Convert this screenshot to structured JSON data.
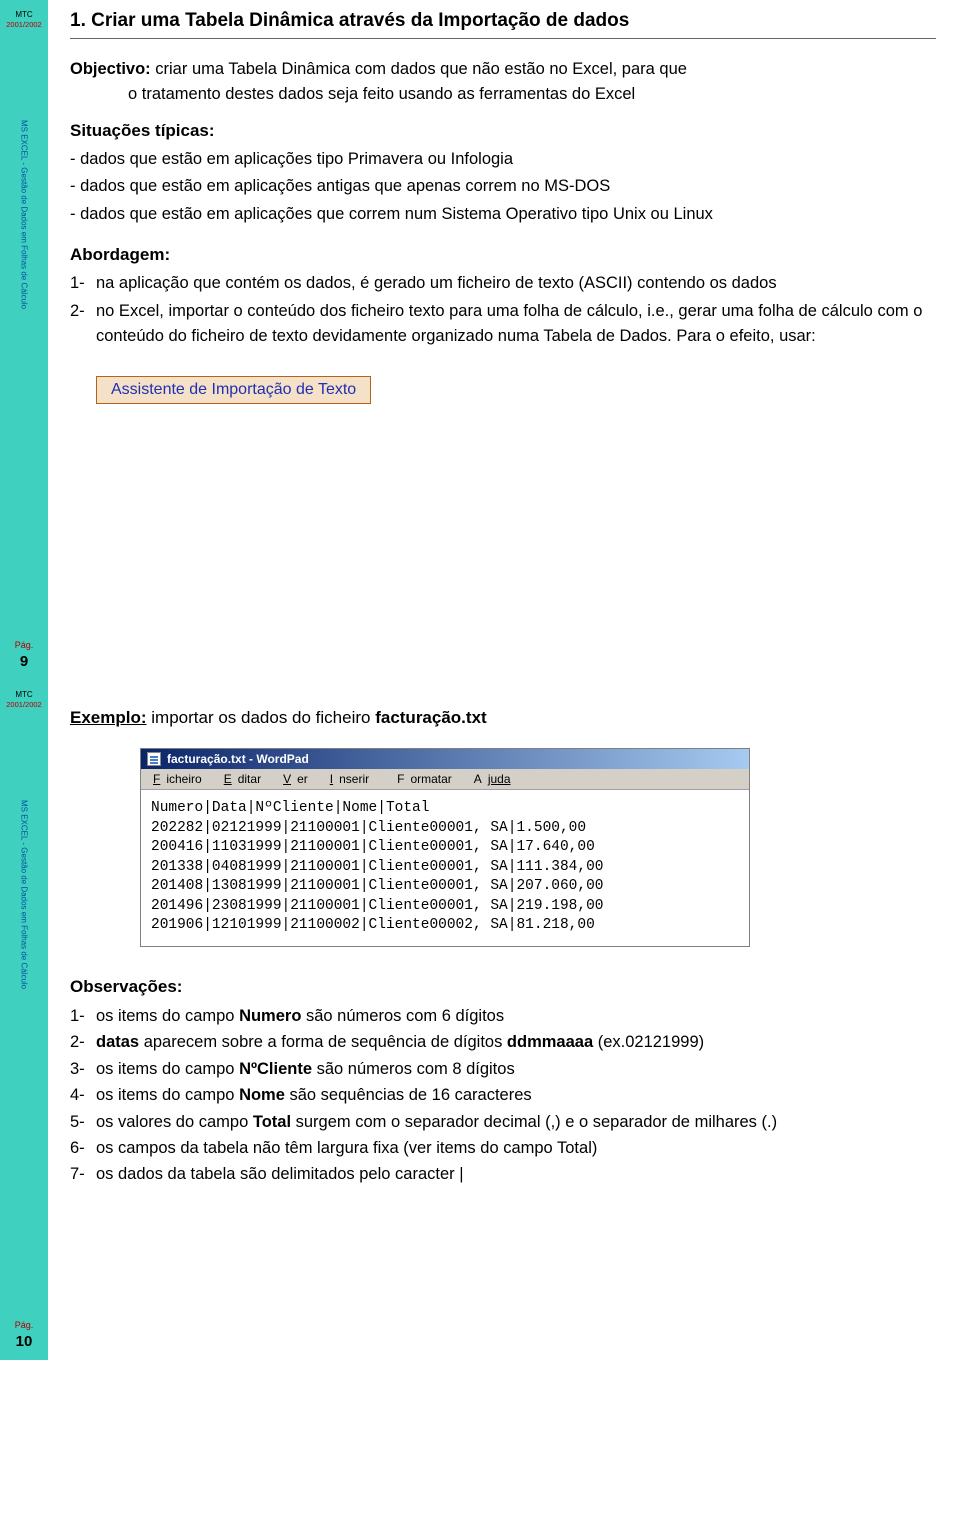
{
  "sidebar": {
    "mtc": "MTC",
    "year": "2001/2002",
    "vertical": "MS EXCEL - Gestão de Dados em Folhas de Cálculo",
    "pag_label": "Pág.",
    "page1_num": "9",
    "page2_num": "10"
  },
  "section1": {
    "title": "1. Criar uma Tabela Dinâmica através da Importação de dados",
    "objectivo_label": "Objectivo:",
    "objectivo_text1": " criar uma Tabela Dinâmica com dados que não estão no Excel, para que",
    "objectivo_text2": "o tratamento destes dados seja feito usando as ferramentas do Excel",
    "situacoes_label": "Situações típicas:",
    "sit_b1": "- dados que estão em aplicações tipo Primavera ou Infologia",
    "sit_b2": "- dados que estão em aplicações antigas que apenas correm no MS-DOS",
    "sit_b3": "- dados que estão em aplicações que correm num Sistema Operativo tipo Unix ou Linux",
    "abordagem_label": "Abordagem:",
    "ab1_prefix": "1-",
    "ab1_text": "na aplicação que contém os dados, é gerado um ficheiro de texto (ASCII) contendo os dados",
    "ab2_prefix": "2-",
    "ab2_text": "no Excel, importar o conteúdo dos ficheiro texto para uma folha de cálculo, i.e., gerar uma folha de cálculo com o conteúdo do ficheiro de texto devidamente organizado numa Tabela de Dados. Para o efeito, usar:",
    "box": "Assistente de Importação de Texto"
  },
  "section2": {
    "exemplo_label": "Exemplo:",
    "exemplo_text": " importar os dados do ficheiro ",
    "exemplo_file": "facturação.txt",
    "wordpad_title": "facturação.txt - WordPad",
    "menus": {
      "ficheiro_u": "F",
      "ficheiro_r": "icheiro",
      "editar_u": "E",
      "editar_r": "ditar",
      "ver_u": "V",
      "ver_r": "er",
      "inserir_u": "I",
      "inserir_r": "nserir",
      "formatar_u": "F",
      "formatar_r": "ormatar",
      "ajuda_u": "A",
      "ajuda_r": "juda"
    },
    "wp_lines": "Numero|Data|NºCliente|Nome|Total\n202282|02121999|21100001|Cliente00001, SA|1.500,00\n200416|11031999|21100001|Cliente00001, SA|17.640,00\n201338|04081999|21100001|Cliente00001, SA|111.384,00\n201408|13081999|21100001|Cliente00001, SA|207.060,00\n201496|23081999|21100001|Cliente00001, SA|219.198,00\n201906|12101999|21100002|Cliente00002, SA|81.218,00",
    "obs_label": "Observações:",
    "o1_prefix": "1-",
    "o1_a": "os items do campo ",
    "o1_b": "Numero",
    "o1_c": " são números com 6 dígitos",
    "o2_prefix": "2-",
    "o2_a": "datas",
    "o2_b": " aparecem sobre a forma de sequência de dígitos ",
    "o2_c": "ddmmaaaa",
    "o2_d": " (ex.02121999)",
    "o3_prefix": "3-",
    "o3_a": "os items do campo ",
    "o3_b": "NºCliente",
    "o3_c": " são números com 8 dígitos",
    "o4_prefix": "4-",
    "o4_a": "os items do campo ",
    "o4_b": "Nome",
    "o4_c": " são sequências de 16 caracteres",
    "o5_prefix": "5-",
    "o5_a": "os valores do campo ",
    "o5_b": "Total",
    "o5_c": " surgem com o separador decimal (,) e o separador de milhares (.)",
    "o6_prefix": "6-",
    "o6": "os campos da tabela não têm largura fixa (ver items do campo Total)",
    "o7_prefix": "7-",
    "o7": "os dados da tabela são delimitados pelo caracter |"
  }
}
